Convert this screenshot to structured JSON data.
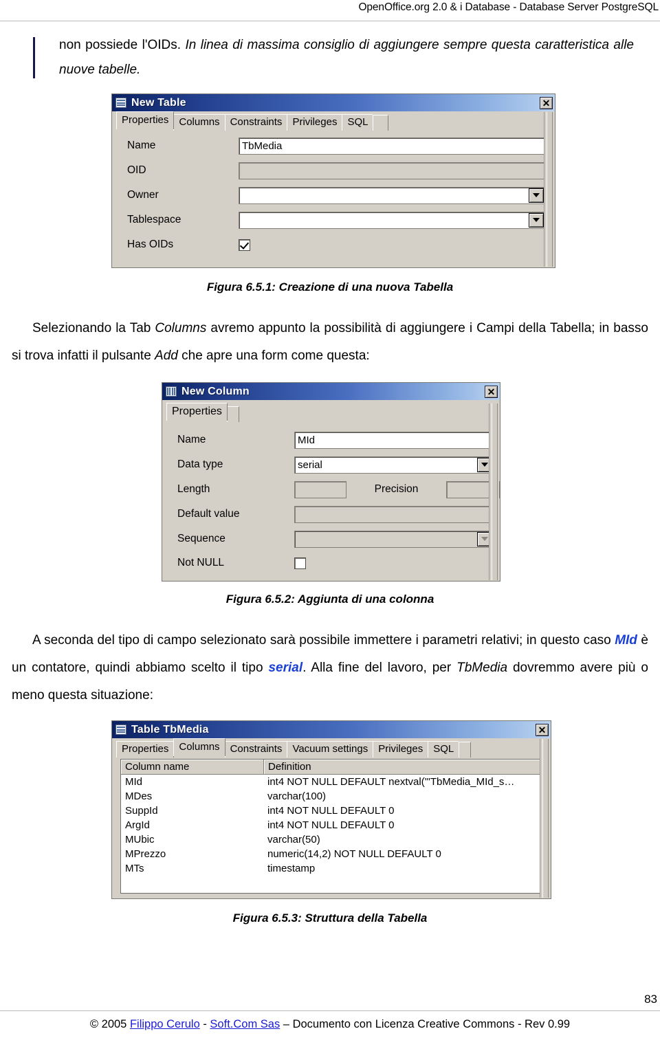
{
  "header": {
    "title": "OpenOffice.org 2.0 & i Database -  Database Server PostgreSQL"
  },
  "note": {
    "line1_plain": "non possiede l'OIDs. ",
    "line1_italic": "In linea di massima consiglio di aggiungere sempre questa",
    "line2_italic": "caratteristica alle nuove tabelle."
  },
  "figures": {
    "fig1": {
      "caption": "Figura 6.5.1: Creazione di una nuova Tabella",
      "title": "New Table",
      "close_label": "✕",
      "tabs": [
        {
          "label": "Properties",
          "active": true
        },
        {
          "label": "Columns",
          "active": false
        },
        {
          "label": "Constraints",
          "active": false
        },
        {
          "label": "Privileges",
          "active": false
        },
        {
          "label": "SQL",
          "active": false
        }
      ],
      "fields": {
        "name_label": "Name",
        "name_value": "TbMedia",
        "oid_label": "OID",
        "oid_value": "",
        "owner_label": "Owner",
        "owner_value": "",
        "tablespace_label": "Tablespace",
        "tablespace_value": "",
        "hasoids_label": "Has OIDs",
        "hasoids_checked": true
      }
    },
    "fig2": {
      "caption": "Figura 6.5.2: Aggiunta di una colonna",
      "title": "New Column",
      "close_label": "✕",
      "tabs": [
        {
          "label": "Properties",
          "active": true
        }
      ],
      "fields": {
        "name_label": "Name",
        "name_value": "MId",
        "datatype_label": "Data type",
        "datatype_value": "serial",
        "length_label": "Length",
        "length_value": "",
        "precision_label": "Precision",
        "precision_value": "",
        "default_label": "Default value",
        "default_value": "",
        "sequence_label": "Sequence",
        "sequence_value": "",
        "notnull_label": "Not NULL",
        "notnull_checked": false
      }
    },
    "fig3": {
      "caption": "Figura 6.5.3: Struttura della Tabella",
      "title": "Table TbMedia",
      "close_label": "✕",
      "tabs": [
        {
          "label": "Properties",
          "active": false
        },
        {
          "label": "Columns",
          "active": true
        },
        {
          "label": "Constraints",
          "active": false
        },
        {
          "label": "Vacuum settings",
          "active": false
        },
        {
          "label": "Privileges",
          "active": false
        },
        {
          "label": "SQL",
          "active": false
        }
      ],
      "grid": {
        "columns": [
          "Column name",
          "Definition"
        ],
        "rows": [
          [
            "MId",
            "int4 NOT NULL DEFAULT nextval('\"TbMedia_MId_s…"
          ],
          [
            "MDes",
            "varchar(100)"
          ],
          [
            "SuppId",
            "int4 NOT NULL DEFAULT 0"
          ],
          [
            "ArgId",
            "int4 NOT NULL DEFAULT 0"
          ],
          [
            "MUbic",
            "varchar(50)"
          ],
          [
            "MPrezzo",
            "numeric(14,2) NOT NULL DEFAULT 0"
          ],
          [
            "MTs",
            "timestamp"
          ]
        ]
      }
    }
  },
  "paragraphs": {
    "p1_a": "Selezionando la Tab ",
    "p1_b": "Columns",
    "p1_c": " avremo appunto la possibilità di aggiungere i Campi della Tabella; in basso si trova infatti il pulsante ",
    "p1_d": "Add",
    "p1_e": " che apre una form come questa:",
    "p2_a": "A seconda del tipo di campo selezionato sarà possibile immettere i parametri relativi; in questo caso ",
    "p2_b": "MId",
    "p2_c": " è un contatore, quindi abbiamo scelto il tipo ",
    "p2_d": "serial",
    "p2_e": ". Alla fine del lavoro, per ",
    "p2_f": "TbMedia",
    "p2_g": " dovremmo avere più o meno questa situazione:"
  },
  "footer": {
    "page_number": "83",
    "copyright_pre": "© 2005 ",
    "link1": "Filippo Cerulo",
    "sep1": " - ",
    "link2": "Soft.Com Sas",
    "copyright_post": " – Documento con Licenza Creative Commons - Rev 0.99"
  },
  "colors": {
    "link": "#1a1ad6",
    "keyword": "#1a3fd4",
    "note_bar": "#17174f",
    "dialog_face": "#d4d0c8",
    "title_dark": "#0b2263",
    "title_light": "#b9d2f0"
  }
}
